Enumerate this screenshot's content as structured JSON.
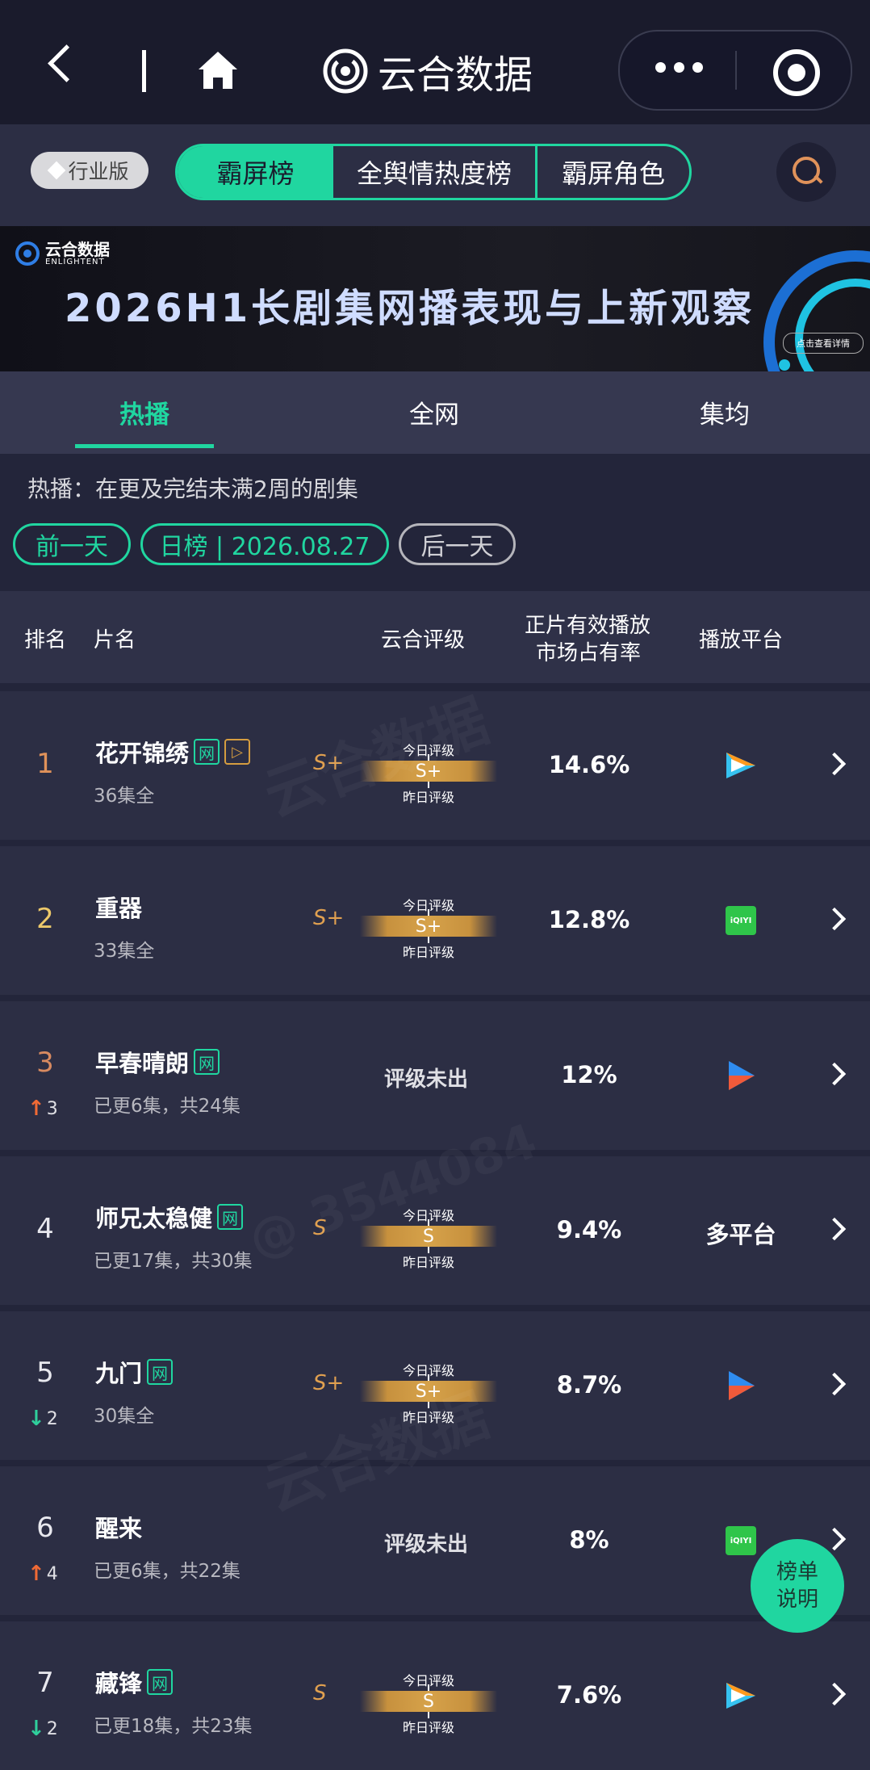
{
  "app": {
    "title": "云合数据"
  },
  "filter": {
    "industry_label": "行业版",
    "segments": [
      "霸屏榜",
      "全舆情热度榜",
      "霸屏角色"
    ]
  },
  "banner": {
    "logo_cn": "云合数据",
    "logo_en": "ENLIGHTENT",
    "title": "2026H1长剧集网播表现与上新观察",
    "button": "点击查看详情"
  },
  "tabs": [
    "热播",
    "全网",
    "集均"
  ],
  "description": "热播：在更及完结未满2周的剧集",
  "date_nav": {
    "prev": "前一天",
    "current": "日榜 | 2026.08.27",
    "next": "后一天"
  },
  "table": {
    "headers": {
      "rank": "排名",
      "title": "片名",
      "rating": "云合评级",
      "share_line1": "正片有效播放",
      "share_line2": "市场占有率",
      "platform": "播放平台"
    },
    "gauge_today": "今日评级",
    "gauge_yesterday": "昨日评级",
    "rows": [
      {
        "rank": "1",
        "title": "花开锦绣",
        "badge": "网",
        "badge2": "▷",
        "episodes": "36集全",
        "rating_prev": "S+",
        "rating_today": "S+",
        "share": "14.6%",
        "platform": "tencent-video",
        "trend": "",
        "trend_dir": ""
      },
      {
        "rank": "2",
        "title": "重器",
        "badge": "",
        "badge2": "",
        "episodes": "33集全",
        "rating_prev": "S+",
        "rating_today": "S+",
        "share": "12.8%",
        "platform": "iqiyi",
        "trend": "",
        "trend_dir": ""
      },
      {
        "rank": "3",
        "title": "早春晴朗",
        "badge": "网",
        "badge2": "",
        "episodes": "已更6集，共24集",
        "rating_text": "评级未出",
        "share": "12%",
        "platform": "youku",
        "trend": "3",
        "trend_dir": "up"
      },
      {
        "rank": "4",
        "title": "师兄太稳健",
        "badge": "网",
        "badge2": "",
        "episodes": "已更17集，共30集",
        "rating_prev": "S",
        "rating_today": "S",
        "share": "9.4%",
        "platform_text": "多平台",
        "trend": "",
        "trend_dir": ""
      },
      {
        "rank": "5",
        "title": "九门",
        "badge": "网",
        "badge2": "",
        "episodes": "30集全",
        "rating_prev": "S+",
        "rating_today": "S+",
        "share": "8.7%",
        "platform": "youku",
        "trend": "2",
        "trend_dir": "down"
      },
      {
        "rank": "6",
        "title": "醒来",
        "badge": "",
        "badge2": "",
        "episodes": "已更6集，共22集",
        "rating_text": "评级未出",
        "share": "8%",
        "platform": "iqiyi",
        "trend": "4",
        "trend_dir": "up"
      },
      {
        "rank": "7",
        "title": "藏锋",
        "badge": "网",
        "badge2": "",
        "episodes": "已更18集，共23集",
        "rating_prev": "S",
        "rating_today": "S",
        "share": "7.6%",
        "platform": "tencent-video",
        "trend": "2",
        "trend_dir": "down"
      }
    ]
  },
  "float_button": {
    "line1": "榜单",
    "line2": "说明"
  },
  "watermark": {
    "text": "云合数据",
    "id_text": "@ 3544084"
  },
  "colors": {
    "accent": "#20d6a0",
    "rank_top": "#e0925a",
    "up": "#f06a35",
    "down": "#2fcf9c",
    "gold": "#d6a24a"
  }
}
